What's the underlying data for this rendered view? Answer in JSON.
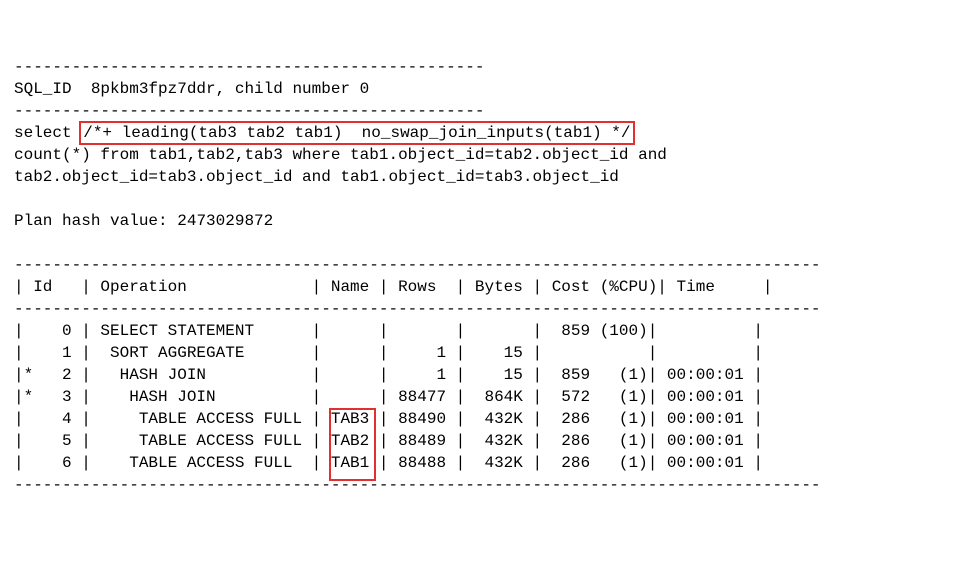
{
  "dashline": "-------------------------------------------------",
  "sql_id_line": {
    "label": "SQL_ID",
    "value": "8pkbm3fpz7ddr, child number 0"
  },
  "query": {
    "pre_hint": "select",
    "hint": "/*+ leading(tab3 tab2 tab1)  no_swap_join_inputs(tab1) */",
    "line2": "count(*) from tab1,tab2,tab3 where tab1.object_id=tab2.object_id and",
    "line3": "tab2.object_id=tab3.object_id and tab1.object_id=tab3.object_id"
  },
  "plan_hash": {
    "label": "Plan hash value:",
    "value": "2473029872"
  },
  "plan_separator": "------------------------------------------------------------------------------------",
  "columns": {
    "id": "Id",
    "operation": "Operation",
    "name": "Name",
    "rows": "Rows",
    "bytes": "Bytes",
    "cost": "Cost (%CPU)",
    "time": "Time"
  },
  "chart_data": {
    "type": "table",
    "title": "Execution Plan",
    "columns": [
      "Id",
      "Operation",
      "Name",
      "Rows",
      "Bytes",
      "Cost (%CPU)",
      "Time"
    ],
    "rows": [
      {
        "pred": " ",
        "id": 0,
        "operation": "SELECT STATEMENT",
        "name": "",
        "rows": "",
        "bytes": "",
        "cost": "859 (100)",
        "time": ""
      },
      {
        "pred": " ",
        "id": 1,
        "operation": " SORT AGGREGATE",
        "name": "",
        "rows": "1",
        "bytes": "15",
        "cost": "",
        "time": ""
      },
      {
        "pred": "*",
        "id": 2,
        "operation": "  HASH JOIN",
        "name": "",
        "rows": "1",
        "bytes": "15",
        "cost": "859   (1)",
        "time": "00:00:01"
      },
      {
        "pred": "*",
        "id": 3,
        "operation": "   HASH JOIN",
        "name": "",
        "rows": "88477",
        "bytes": "864K",
        "cost": "572   (1)",
        "time": "00:00:01"
      },
      {
        "pred": " ",
        "id": 4,
        "operation": "    TABLE ACCESS FULL",
        "name": "TAB3",
        "rows": "88490",
        "bytes": "432K",
        "cost": "286   (1)",
        "time": "00:00:01"
      },
      {
        "pred": " ",
        "id": 5,
        "operation": "    TABLE ACCESS FULL",
        "name": "TAB2",
        "rows": "88489",
        "bytes": "432K",
        "cost": "286   (1)",
        "time": "00:00:01"
      },
      {
        "pred": " ",
        "id": 6,
        "operation": "   TABLE ACCESS FULL",
        "name": "TAB1",
        "rows": "88488",
        "bytes": "432K",
        "cost": "286   (1)",
        "time": "00:00:01"
      }
    ]
  }
}
